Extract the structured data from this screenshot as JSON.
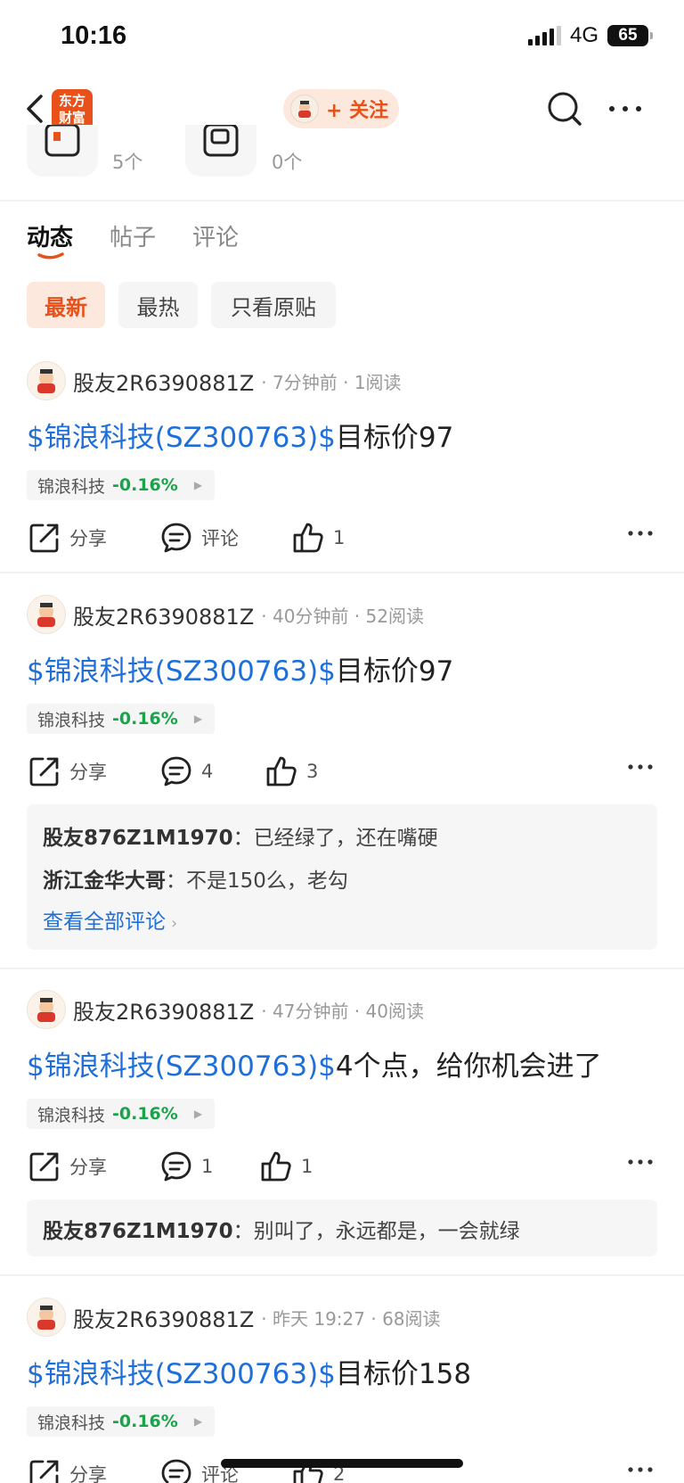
{
  "status_bar": {
    "time": "10:16",
    "network": "4G",
    "battery": "65"
  },
  "nav": {
    "logo_line1": "东方",
    "logo_line2": "财富",
    "follow_label": "+ 关注"
  },
  "header": {
    "count_a": "5个",
    "count_b": "0个"
  },
  "tabs": [
    {
      "label": "动态"
    },
    {
      "label": "帖子"
    },
    {
      "label": "评论"
    }
  ],
  "filters": [
    {
      "label": "最新"
    },
    {
      "label": "最热"
    },
    {
      "label": "只看原贴"
    }
  ],
  "accent": "#e8521a",
  "link_color": "#1e6fd9",
  "down_color": "#1aa34a",
  "posts": [
    {
      "user": "股友2R6390881Z",
      "time": "7分钟前",
      "reads": "1阅读",
      "ticker": "$锦浪科技(SZ300763)$",
      "text": "目标价97",
      "stock_name": "锦浪科技",
      "stock_change": "-0.16%",
      "share_label": "分享",
      "comment_value": "评论",
      "like_value": "1",
      "comments": []
    },
    {
      "user": "股友2R6390881Z",
      "time": "40分钟前",
      "reads": "52阅读",
      "ticker": "$锦浪科技(SZ300763)$",
      "text": "目标价97",
      "stock_name": "锦浪科技",
      "stock_change": "-0.16%",
      "share_label": "分享",
      "comment_value": "4",
      "like_value": "3",
      "comments": [
        {
          "author": "股友876Z1M1970",
          "sep": "：",
          "text": "已经绿了，还在嘴硬"
        },
        {
          "author": "浙江金华大哥",
          "sep": "：",
          "text": "不是150么，老勾"
        }
      ],
      "view_all": "查看全部评论"
    },
    {
      "user": "股友2R6390881Z",
      "time": "47分钟前",
      "reads": "40阅读",
      "ticker": "$锦浪科技(SZ300763)$",
      "text": "4个点，给你机会进了",
      "stock_name": "锦浪科技",
      "stock_change": "-0.16%",
      "share_label": "分享",
      "comment_value": "1",
      "like_value": "1",
      "comments": [
        {
          "author": "股友876Z1M1970",
          "sep": "：",
          "text": "别叫了，永远都是，一会就绿"
        }
      ]
    },
    {
      "user": "股友2R6390881Z",
      "time": "昨天 19:27",
      "reads": "68阅读",
      "ticker": "$锦浪科技(SZ300763)$",
      "text": "目标价158",
      "stock_name": "锦浪科技",
      "stock_change": "-0.16%",
      "share_label": "分享",
      "comment_value": "评论",
      "like_value": "2",
      "comments": []
    }
  ]
}
